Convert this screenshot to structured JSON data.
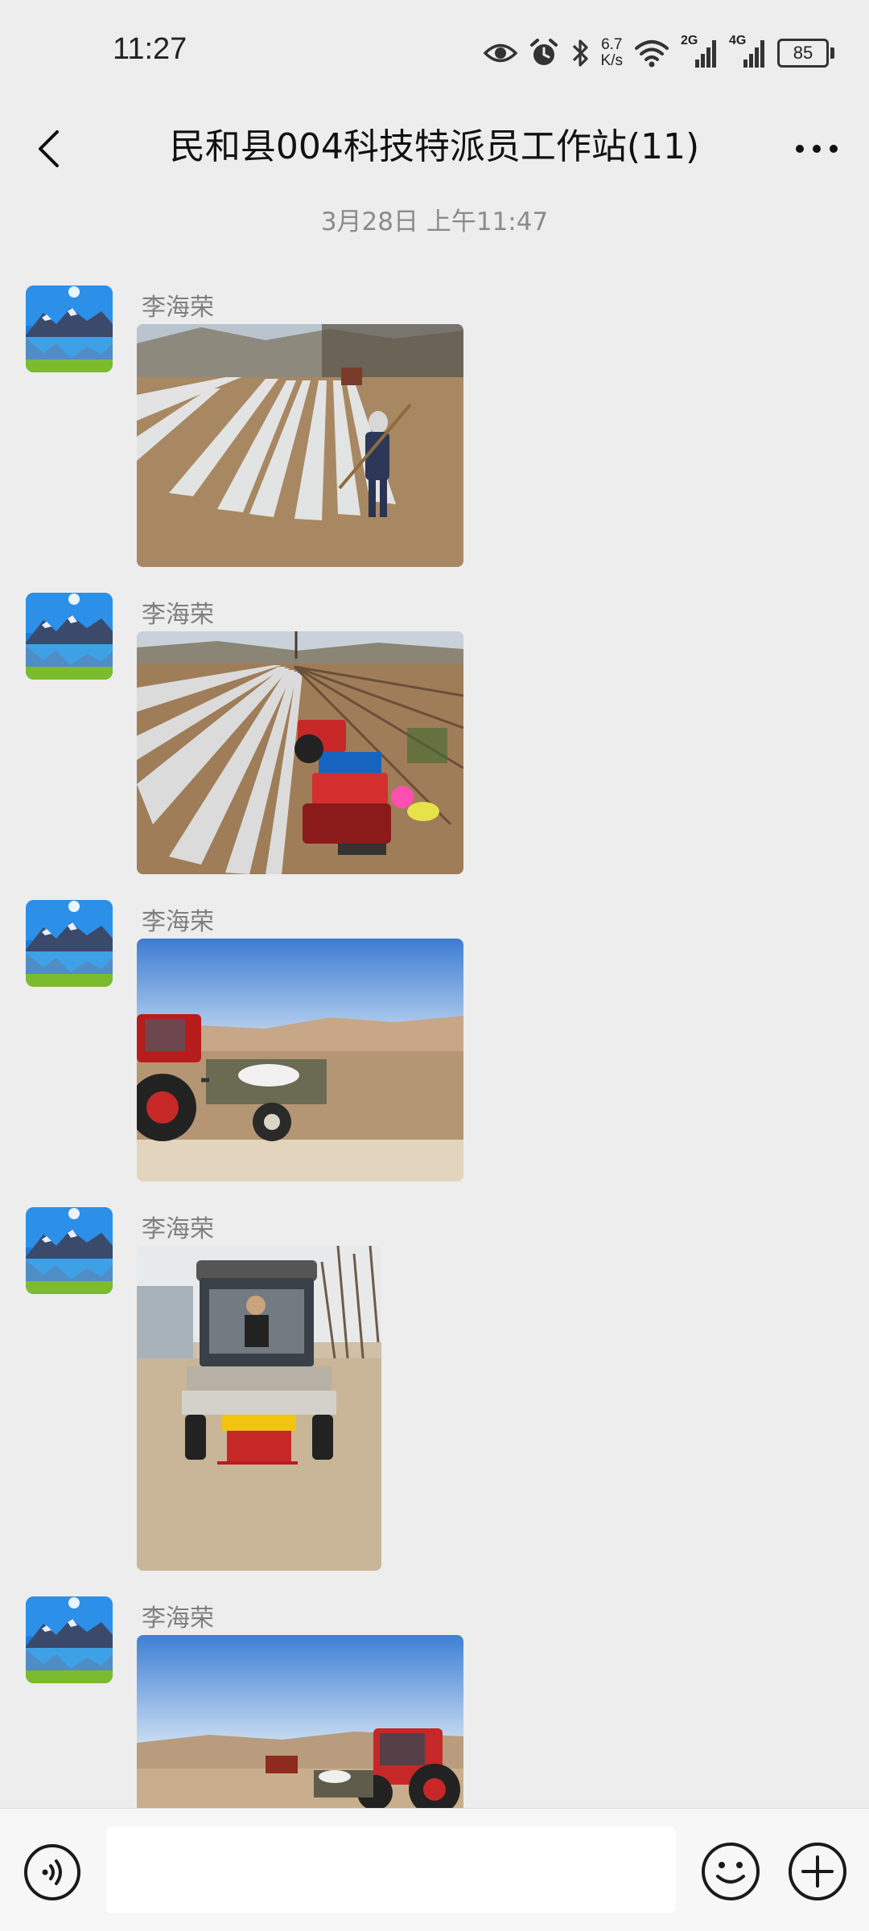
{
  "status_bar": {
    "time": "11:27",
    "net_speed_value": "6.7",
    "net_speed_unit": "K/s",
    "sim1_label": "2G",
    "sim2_label": "4G",
    "battery_level": "85",
    "icons": [
      "eye-icon",
      "alarm-icon",
      "bluetooth-icon",
      "wifi-icon",
      "signal-icon",
      "signal-icon",
      "battery-icon"
    ]
  },
  "header": {
    "title": "民和县004科技特派员工作站(11)",
    "back_icon": "chevron-left-icon",
    "more_icon": "more-dots-icon"
  },
  "chat": {
    "timestamp": "3月28日 上午11:47",
    "messages": [
      {
        "sender": "李海荣",
        "type": "image"
      },
      {
        "sender": "李海荣",
        "type": "image"
      },
      {
        "sender": "李海荣",
        "type": "image"
      },
      {
        "sender": "李海荣",
        "type": "image"
      },
      {
        "sender": "李海荣",
        "type": "image"
      }
    ]
  },
  "input_bar": {
    "value": "",
    "placeholder": "",
    "voice_icon": "voice-icon",
    "emoji_icon": "emoji-icon",
    "plus_icon": "plus-icon"
  },
  "colors": {
    "background": "#ededed",
    "input_bar": "#f7f7f7",
    "muted_text": "#8b8b8b"
  }
}
